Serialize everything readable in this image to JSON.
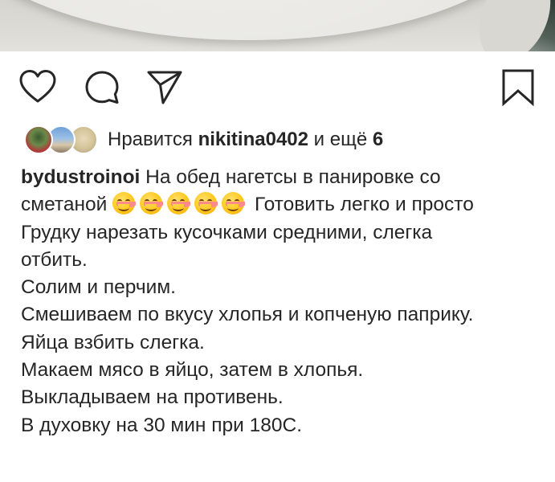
{
  "post": {
    "likes": {
      "prefix": "Нравится",
      "user": "nikitina0402",
      "suffix": "и ещё",
      "count": "6"
    },
    "caption": {
      "author": "bydustroinoi",
      "line1_text": "На обед нагетсы в панировке со",
      "line2_start": "сметаной",
      "emoji_count": 5,
      "emoji_name": "smiling-face-emoji",
      "line2_end": "Готовить легко и просто",
      "line3": "Грудку нарезать кусочками средними, слегка",
      "line4": "отбить.",
      "line5": "Солим и перчим.",
      "line6": "Смешиваем по вкусу хлопья и копченую паприку.",
      "line7": "Яйца взбить слегка.",
      "line8": "Макаем мясо в яйцо, затем в хлопья.",
      "line9": "Выкладываем на противень.",
      "line10": "В духовку на 30 мин при 180С."
    },
    "actions": {
      "like_icon": "heart-icon",
      "comment_icon": "comment-icon",
      "share_icon": "send-icon",
      "save_icon": "bookmark-icon"
    },
    "colors": {
      "text": "#262626",
      "background": "#ffffff"
    }
  }
}
